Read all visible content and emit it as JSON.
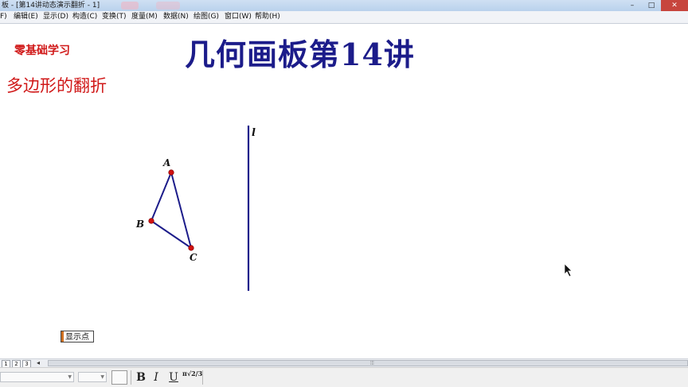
{
  "window": {
    "title": "板 - [第14讲动态演示翻折 - 1]",
    "minimize": "–",
    "maximize": "□",
    "close": "✕"
  },
  "menu": {
    "items": [
      "F)",
      "编辑(E)",
      "显示(D)",
      "构造(C)",
      "变换(T)",
      "度量(M)",
      "数据(N)",
      "绘图(G)",
      "窗口(W)",
      "帮助(H)"
    ]
  },
  "headings": {
    "main": "几何画板第14讲",
    "sub1": "零基础学习",
    "sub2": "多边形的翻折"
  },
  "sketch": {
    "points": [
      {
        "label": "A"
      },
      {
        "label": "B"
      },
      {
        "label": "C"
      }
    ],
    "line_label": "l",
    "stroke_color": "#1c1c8a",
    "point_color": "#d01010"
  },
  "show_button": "显示点",
  "page_tabs": [
    "1",
    "2",
    "3"
  ],
  "page_tab_arrow": "◂",
  "scroll_grip": "⦙⦙⦙",
  "toolbar": {
    "bold": "B",
    "italic": "I",
    "underline": "U",
    "math": "π√2/3"
  }
}
